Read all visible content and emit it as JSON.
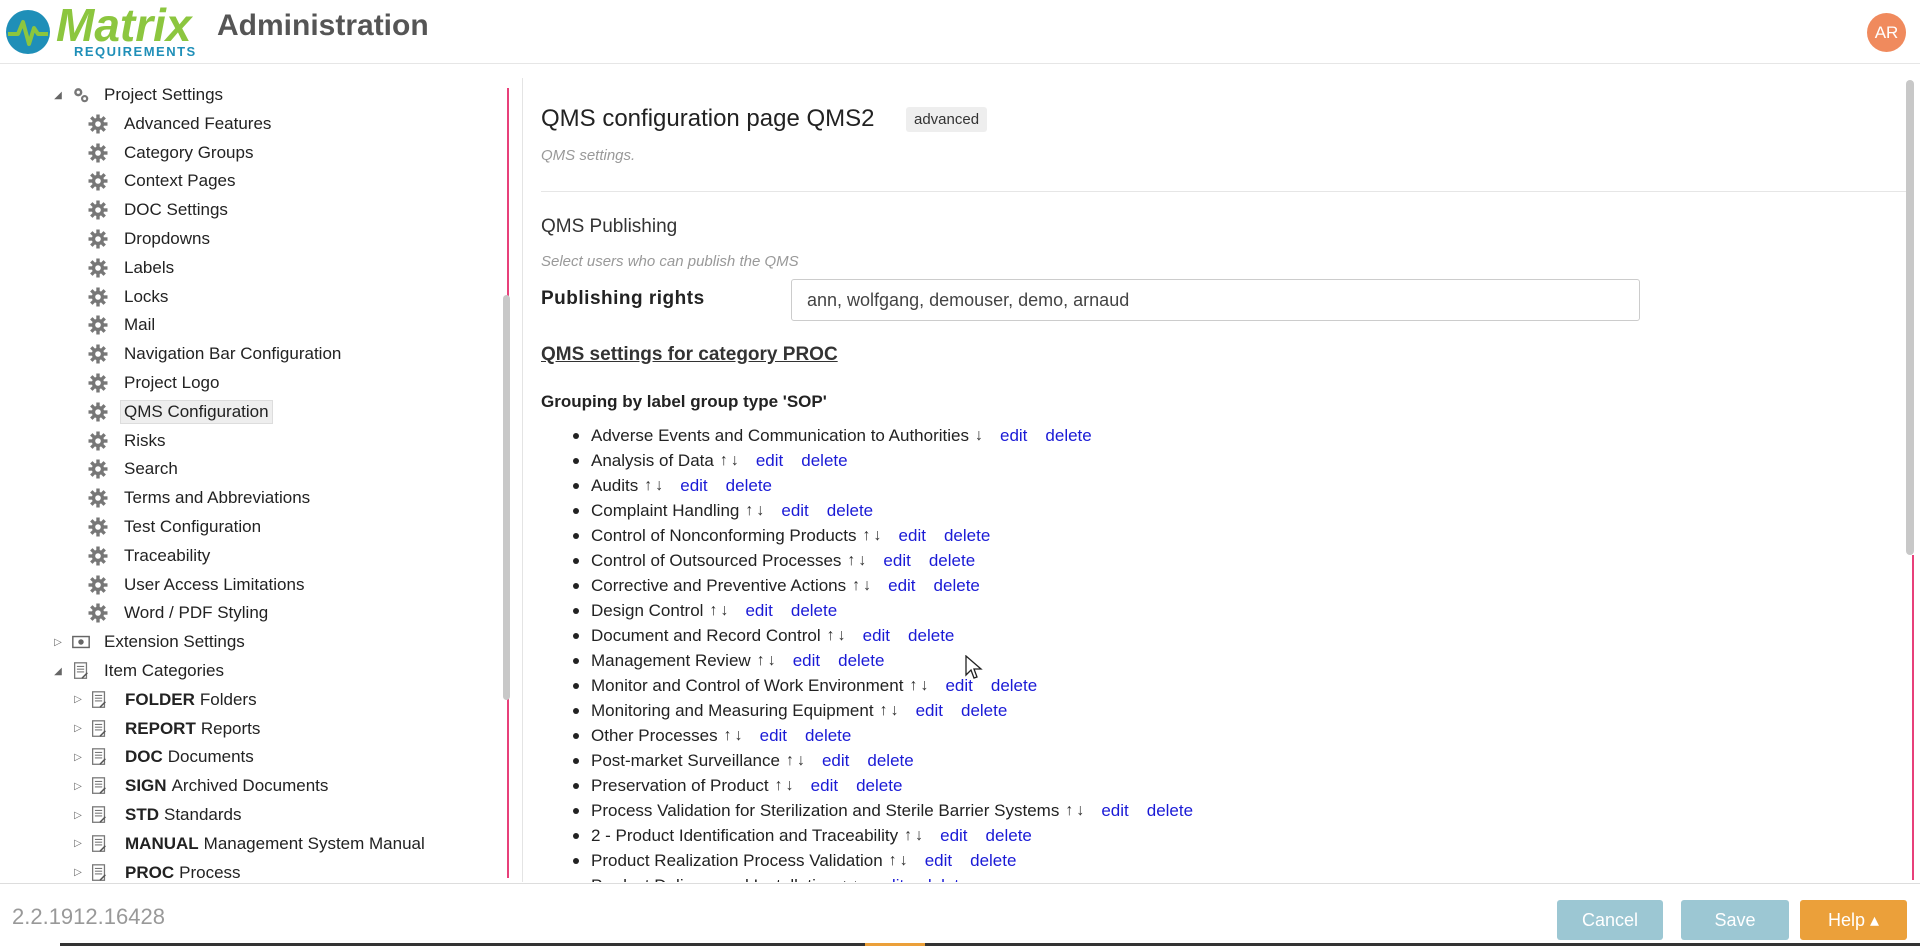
{
  "header": {
    "logo_main": "Matrix",
    "logo_sub": "REQUIREMENTS",
    "title": "Administration",
    "avatar_initials": "AR",
    "accent_green": "#8cc63f",
    "accent_blue": "#1f8fb8"
  },
  "sidebar": {
    "project_settings_label": "Project Settings",
    "settings_items": [
      "Advanced Features",
      "Category Groups",
      "Context Pages",
      "DOC Settings",
      "Dropdowns",
      "Labels",
      "Locks",
      "Mail",
      "Navigation Bar Configuration",
      "Project Logo",
      "QMS Configuration",
      "Risks",
      "Search",
      "Terms and Abbreviations",
      "Test Configuration",
      "Traceability",
      "User Access Limitations",
      "Word / PDF Styling"
    ],
    "selected_item": "QMS Configuration",
    "extension_settings_label": "Extension Settings",
    "item_categories_label": "Item Categories",
    "categories": [
      {
        "code": "FOLDER",
        "name": "Folders"
      },
      {
        "code": "REPORT",
        "name": "Reports"
      },
      {
        "code": "DOC",
        "name": "Documents"
      },
      {
        "code": "SIGN",
        "name": "Archived Documents"
      },
      {
        "code": "STD",
        "name": "Standards"
      },
      {
        "code": "MANUAL",
        "name": "Management System Manual"
      },
      {
        "code": "PROC",
        "name": "Process"
      }
    ]
  },
  "main": {
    "page_title": "QMS configuration page QMS2",
    "badge": "advanced",
    "page_subtitle": "QMS settings.",
    "publishing_heading": "QMS Publishing",
    "publishing_hint": "Select users who can publish the QMS",
    "publishing_label": "Publishing rights",
    "publishing_value": "ann, wolfgang, demouser, demo, arnaud",
    "category_heading": "QMS settings for category PROC",
    "grouping_heading": "Grouping by label group type 'SOP'",
    "edit_label": "edit",
    "delete_label": "delete",
    "sop_items": [
      {
        "name": "Adverse Events and Communication to Authorities",
        "arrows": "↓"
      },
      {
        "name": "Analysis of Data",
        "arrows": "↑↓"
      },
      {
        "name": "Audits",
        "arrows": "↑↓"
      },
      {
        "name": "Complaint Handling",
        "arrows": "↑↓"
      },
      {
        "name": "Control of Nonconforming Products",
        "arrows": "↑↓"
      },
      {
        "name": "Control of Outsourced Processes",
        "arrows": "↑↓"
      },
      {
        "name": "Corrective and Preventive Actions",
        "arrows": "↑↓"
      },
      {
        "name": "Design Control",
        "arrows": "↑↓"
      },
      {
        "name": "Document and Record Control",
        "arrows": "↑↓"
      },
      {
        "name": "Management Review",
        "arrows": "↑↓"
      },
      {
        "name": "Monitor and Control of Work Environment",
        "arrows": "↑↓"
      },
      {
        "name": "Monitoring and Measuring Equipment",
        "arrows": "↑↓"
      },
      {
        "name": "Other Processes",
        "arrows": "↑↓"
      },
      {
        "name": "Post-market Surveillance",
        "arrows": "↑↓"
      },
      {
        "name": "Preservation of Product",
        "arrows": "↑↓"
      },
      {
        "name": "Process Validation for Sterilization and Sterile Barrier Systems",
        "arrows": "↑↓"
      },
      {
        "name": "2 - Product Identification and Traceability",
        "arrows": "↑↓"
      },
      {
        "name": "Product Realization Process Validation",
        "arrows": "↑↓"
      },
      {
        "name": "Product Delivery and Installation",
        "arrows": "↑↓"
      }
    ]
  },
  "footer": {
    "version": "2.2.1912.16428",
    "cancel_label": "Cancel",
    "save_label": "Save",
    "help_label": "Help ▴",
    "button_color": "#9cc7d3",
    "help_color": "#eba03a"
  }
}
